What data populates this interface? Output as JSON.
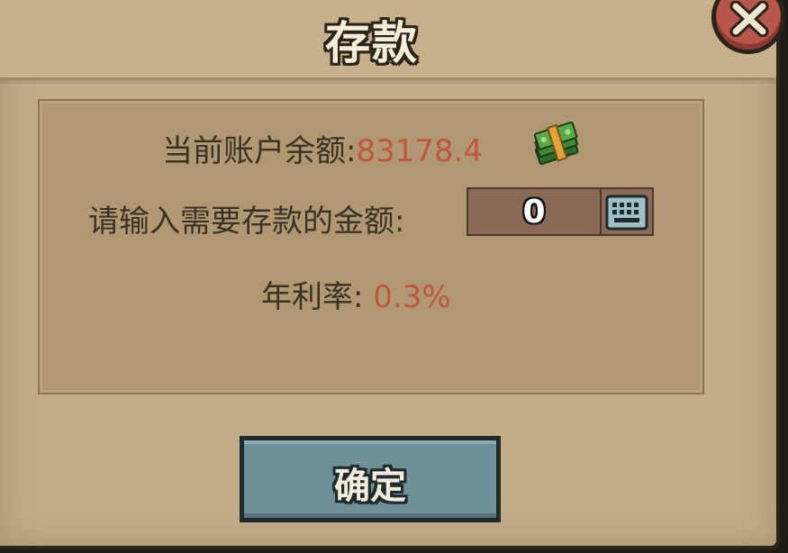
{
  "dialog": {
    "title": "存款",
    "close_icon": "close-x-icon"
  },
  "account": {
    "balance_label": "当前账户余额:",
    "balance_value": "83178.4",
    "currency_icon": "cash-stack-icon"
  },
  "deposit": {
    "prompt_label": "请输入需要存款的金额:",
    "amount_value": "0",
    "keyboard_icon": "keyboard-icon"
  },
  "interest": {
    "label": "年利率:",
    "value": "0.3%"
  },
  "actions": {
    "confirm_label": "确定"
  },
  "colors": {
    "panel": "#c3ad88",
    "value_red": "#c25541",
    "button_teal": "#6f9098",
    "close_red": "#b9564b"
  }
}
